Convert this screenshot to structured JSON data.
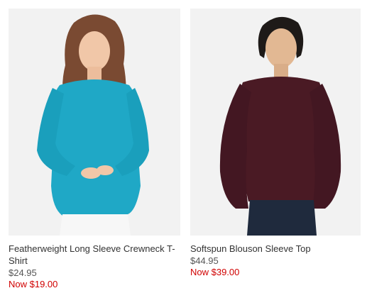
{
  "colors": {
    "sale": "#d00000",
    "text": "#333333",
    "photo_bg": "#f2f2f2",
    "shirt_teal": "#1fa8c6",
    "top_burgundy": "#4a1a24"
  },
  "products": [
    {
      "name": "Featherweight Long Sleeve Crewneck T-Shirt",
      "price": "$24.95",
      "sale_price": "Now $19.00",
      "image": "product-photo-teal-tee"
    },
    {
      "name": "Softspun Blouson Sleeve Top",
      "price": "$44.95",
      "sale_price": "Now $39.00",
      "image": "product-photo-burgundy-top"
    }
  ]
}
